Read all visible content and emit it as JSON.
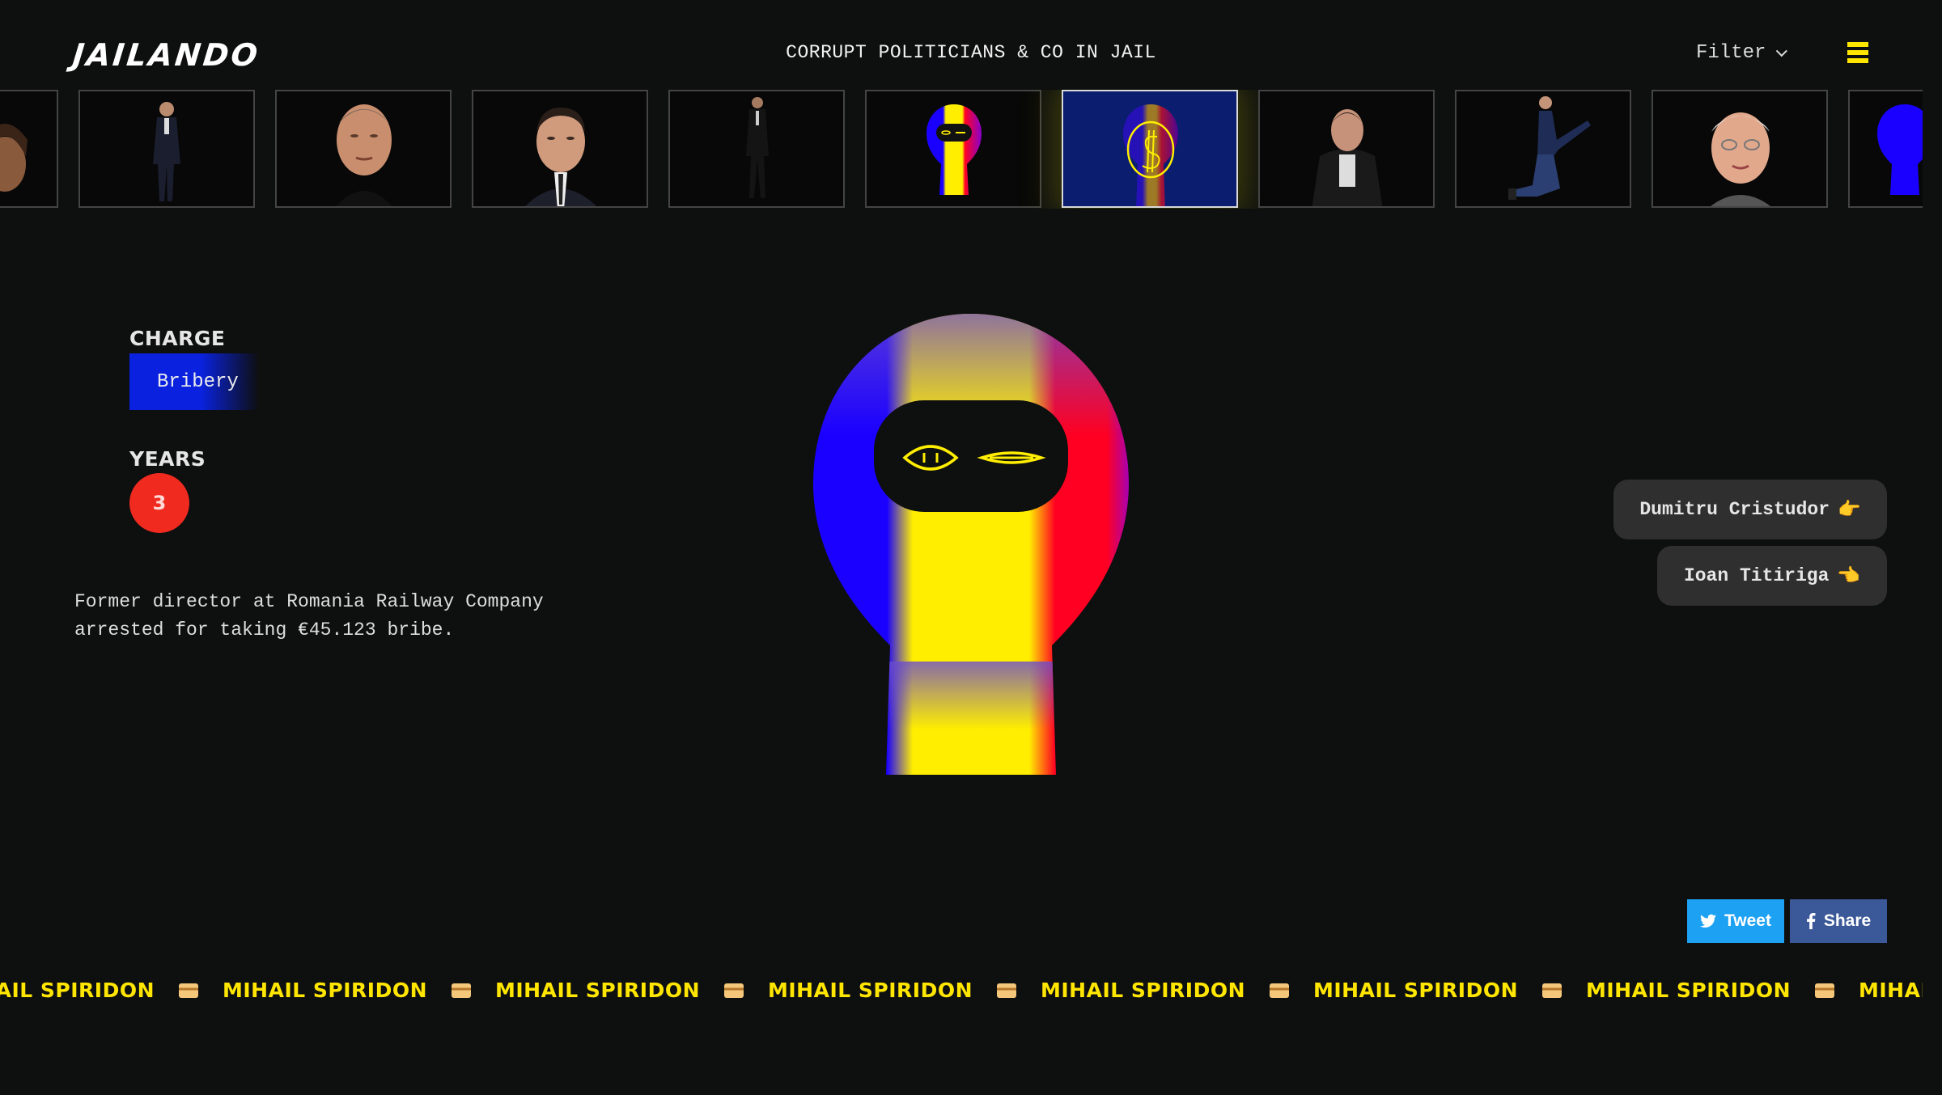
{
  "header": {
    "logo": "JAILANDO",
    "tagline": "CORRUPT POLITICIANS & CO IN JAIL",
    "filter_label": "Filter",
    "menu_icon": "hamburger-icon"
  },
  "thumbnails": [
    {
      "name": "thumb-partial-left",
      "kind": "portrait"
    },
    {
      "name": "thumb-suit-standing",
      "kind": "standing"
    },
    {
      "name": "thumb-bald-man",
      "kind": "portrait"
    },
    {
      "name": "thumb-man-tie",
      "kind": "portrait"
    },
    {
      "name": "thumb-man-walking",
      "kind": "standing"
    },
    {
      "name": "thumb-masked-avatar",
      "kind": "avatar"
    },
    {
      "name": "thumb-dollar-avatar",
      "kind": "avatar-active"
    },
    {
      "name": "thumb-man-jacket",
      "kind": "portrait"
    },
    {
      "name": "thumb-man-jumping",
      "kind": "standing"
    },
    {
      "name": "thumb-old-man",
      "kind": "portrait"
    },
    {
      "name": "thumb-partial-right",
      "kind": "avatar"
    }
  ],
  "profile": {
    "charge_label": "CHARGE",
    "charge_value": "Bribery",
    "years_label": "YEARS",
    "years_value": "3",
    "description": "Former director at Romania Railway Company arrested for taking €45.123 bribe."
  },
  "navigation": {
    "prev_name": "Dumitru Cristudor",
    "prev_icon": "👉",
    "next_name": "Ioan Titiriga",
    "next_icon": "👈"
  },
  "share": {
    "tweet_label": "Tweet",
    "share_label": "Share"
  },
  "marquee": {
    "name": "MIHAIL SPIRIDON",
    "separator_icon": "credit-card-icon"
  },
  "colors": {
    "background": "#0e0f0f",
    "accent_yellow": "#ffe600",
    "flag_blue": "#1a00ff",
    "flag_red": "#ff0022",
    "years_red": "#f02a1f",
    "twitter": "#1da1f2",
    "facebook": "#3b5998"
  }
}
